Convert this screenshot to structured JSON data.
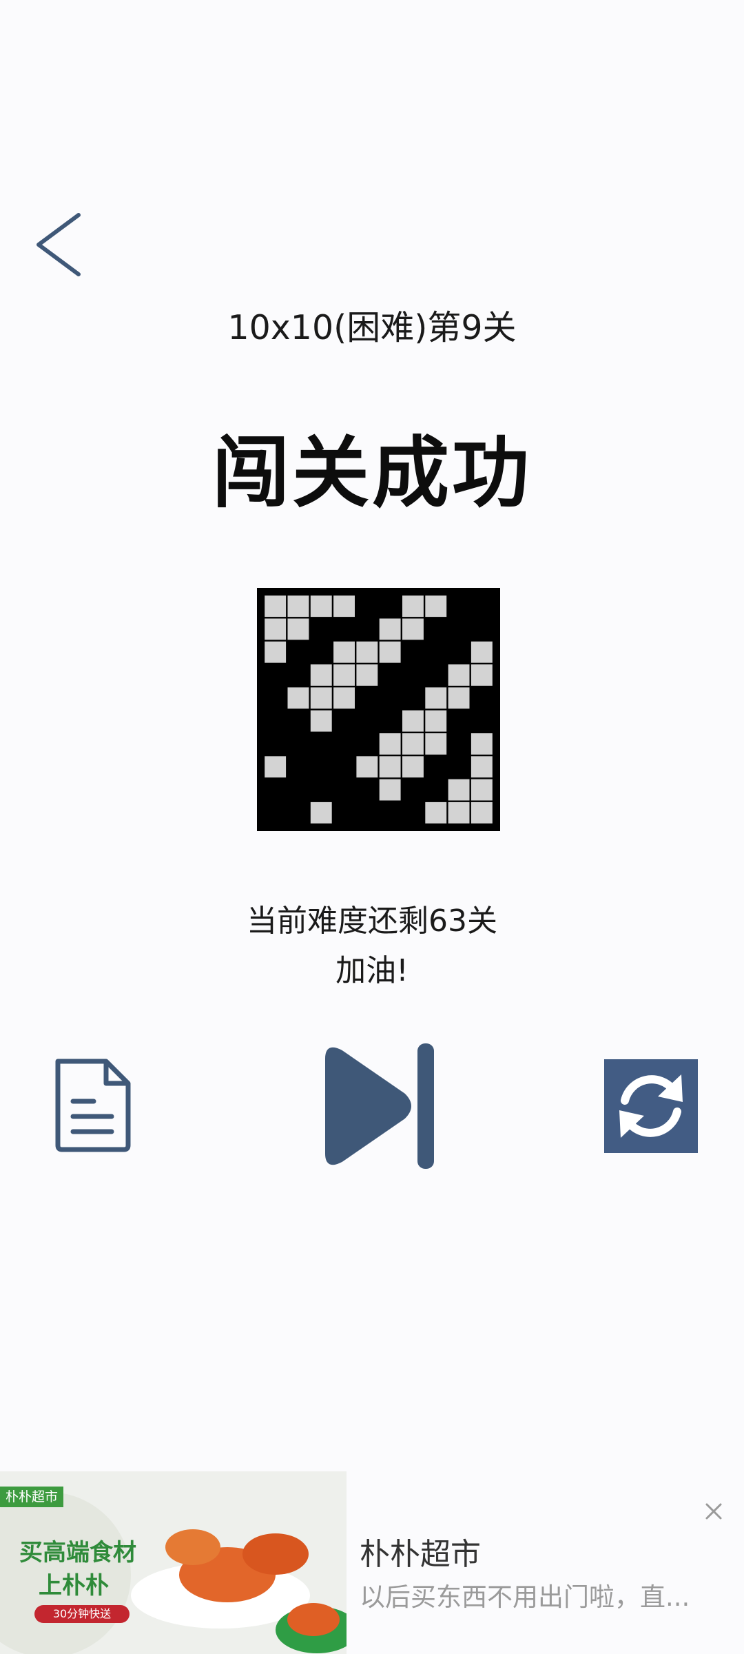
{
  "level": {
    "title": "10x10(困难)第9关",
    "result": "闯关成功",
    "remaining": "当前难度还剩63关",
    "cheer": "加油!"
  },
  "board": {
    "rows": 10,
    "cols": 10,
    "filled_color": "#000000",
    "empty_color": "#d3d3d3",
    "cells": [
      [
        0,
        0,
        0,
        0,
        1,
        1,
        0,
        0,
        1,
        1
      ],
      [
        0,
        0,
        1,
        1,
        1,
        0,
        0,
        1,
        1,
        1
      ],
      [
        0,
        1,
        1,
        0,
        0,
        0,
        1,
        1,
        1,
        0
      ],
      [
        1,
        1,
        0,
        0,
        0,
        1,
        1,
        1,
        0,
        0
      ],
      [
        1,
        0,
        0,
        0,
        1,
        1,
        1,
        0,
        0,
        1
      ],
      [
        1,
        1,
        0,
        1,
        1,
        1,
        0,
        0,
        1,
        1
      ],
      [
        1,
        1,
        1,
        1,
        1,
        0,
        0,
        0,
        1,
        0
      ],
      [
        0,
        1,
        1,
        1,
        0,
        0,
        0,
        1,
        1,
        0
      ],
      [
        1,
        1,
        1,
        1,
        1,
        0,
        1,
        1,
        0,
        0
      ],
      [
        1,
        1,
        0,
        1,
        1,
        1,
        1,
        0,
        0,
        0
      ]
    ]
  },
  "icons": {
    "back": "chevron-left-icon",
    "doc": "document-icon",
    "next": "skip-next-icon",
    "refresh": "refresh-icon",
    "close": "close-icon"
  },
  "colors": {
    "accent": "#3f5878",
    "refresh_bg": "#425c84"
  },
  "ad": {
    "brand_tag": "朴朴超市",
    "slogan_line1": "买高端食材",
    "slogan_line2": "上朴朴",
    "pill": "30分钟快送",
    "title": "朴朴超市",
    "description": "以后买东西不用出门啦，直..."
  }
}
